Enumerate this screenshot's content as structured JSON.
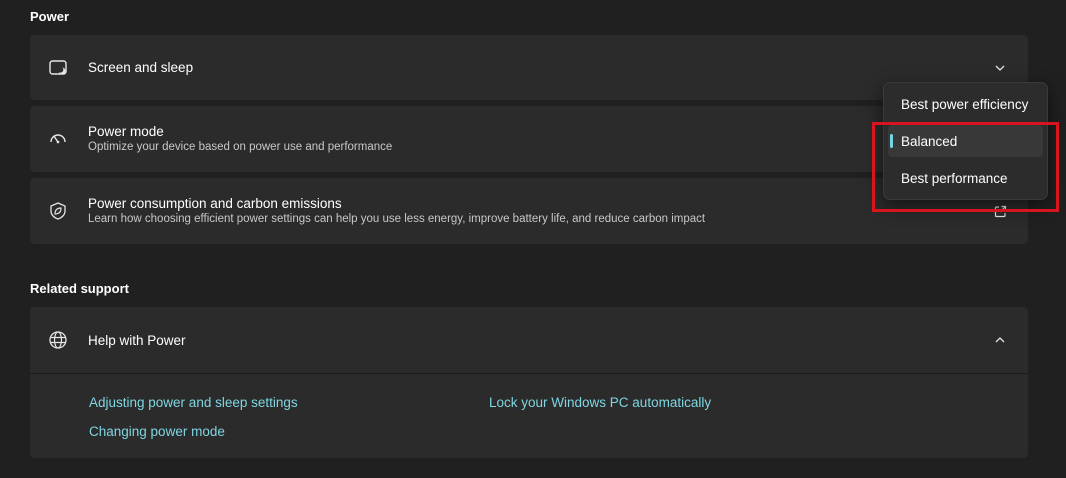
{
  "sections": {
    "power_title": "Power",
    "related_title": "Related support"
  },
  "screen_sleep": {
    "title": "Screen and sleep",
    "icon": "screen-sleep-icon"
  },
  "power_mode": {
    "title": "Power mode",
    "subtitle": "Optimize your device based on power use and performance",
    "icon": "gauge-icon"
  },
  "carbon": {
    "title": "Power consumption and carbon emissions",
    "subtitle": "Learn how choosing efficient power settings can help you use less energy, improve battery life, and reduce carbon impact",
    "icon": "leaf-shield-icon"
  },
  "help": {
    "title": "Help with Power",
    "icon": "globe-icon",
    "links": [
      "Adjusting power and sleep settings",
      "Changing power mode",
      "Lock your Windows PC automatically"
    ]
  },
  "power_mode_dropdown": {
    "options": [
      "Best power efficiency",
      "Balanced",
      "Best performance"
    ],
    "selected": "Balanced"
  },
  "colors": {
    "background": "#202020",
    "card": "#2b2b2b",
    "accent": "#76d4e6",
    "link": "#7fd6e2",
    "highlight": "#d8141e"
  }
}
